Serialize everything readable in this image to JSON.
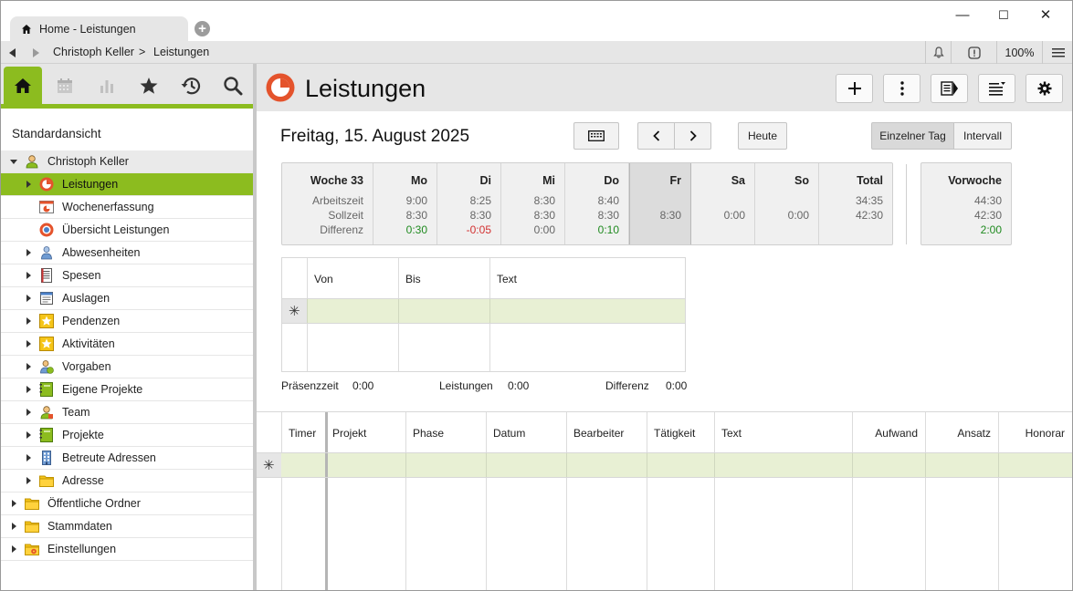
{
  "window": {
    "tab_title": "Home - Leistungen",
    "minimize": "—",
    "maximize": "☐",
    "close": "✕"
  },
  "address": {
    "crumbs": [
      "Christoph Keller",
      ">",
      "Leistungen"
    ],
    "zoom": "100%"
  },
  "sidebar": {
    "heading": "Standardansicht",
    "items": [
      {
        "label": "Christoph Keller",
        "level": 0,
        "expander": "down",
        "icon": "user-icon",
        "state": "grey"
      },
      {
        "label": "Leistungen",
        "level": 1,
        "expander": "right",
        "icon": "leistungen-icon",
        "state": "selected"
      },
      {
        "label": "Wochenerfassung",
        "level": 1,
        "expander": "none",
        "icon": "wochenerfassung-icon",
        "state": ""
      },
      {
        "label": "Übersicht Leistungen",
        "level": 1,
        "expander": "none",
        "icon": "uebersicht-icon",
        "state": ""
      },
      {
        "label": "Abwesenheiten",
        "level": 1,
        "expander": "right",
        "icon": "absence-icon",
        "state": ""
      },
      {
        "label": "Spesen",
        "level": 1,
        "expander": "right",
        "icon": "spesen-icon",
        "state": ""
      },
      {
        "label": "Auslagen",
        "level": 1,
        "expander": "right",
        "icon": "auslagen-icon",
        "state": ""
      },
      {
        "label": "Pendenzen",
        "level": 1,
        "expander": "right",
        "icon": "star-box-icon",
        "state": ""
      },
      {
        "label": "Aktivitäten",
        "level": 1,
        "expander": "right",
        "icon": "star-box-icon",
        "state": ""
      },
      {
        "label": "Vorgaben",
        "level": 1,
        "expander": "right",
        "icon": "vorgaben-icon",
        "state": ""
      },
      {
        "label": "Eigene Projekte",
        "level": 1,
        "expander": "right",
        "icon": "project-icon",
        "state": ""
      },
      {
        "label": "Team",
        "level": 1,
        "expander": "right",
        "icon": "team-icon",
        "state": ""
      },
      {
        "label": "Projekte",
        "level": 1,
        "expander": "right",
        "icon": "project-icon",
        "state": ""
      },
      {
        "label": "Betreute Adressen",
        "level": 1,
        "expander": "right",
        "icon": "building-icon",
        "state": ""
      },
      {
        "label": "Adresse",
        "level": 1,
        "expander": "right",
        "icon": "folder-icon",
        "state": ""
      },
      {
        "label": "Öffentliche Ordner",
        "level": 0,
        "expander": "right",
        "icon": "folder-icon",
        "state": ""
      },
      {
        "label": "Stammdaten",
        "level": 0,
        "expander": "right",
        "icon": "folder-icon",
        "state": ""
      },
      {
        "label": "Einstellungen",
        "level": 0,
        "expander": "right",
        "icon": "settings-folder-icon",
        "state": ""
      }
    ]
  },
  "main": {
    "title": "Leistungen",
    "date": "Freitag, 15. August 2025",
    "today_btn": "Heute",
    "view_single": "Einzelner Tag",
    "view_interval": "Intervall",
    "week": {
      "label": "Woche 33",
      "row_labels": [
        "Arbeitszeit",
        "Sollzeit",
        "Differenz"
      ],
      "days": [
        {
          "name": "Mo",
          "arbeitszeit": "9:00",
          "sollzeit": "8:30",
          "differenz": "0:30",
          "diff_state": "positive"
        },
        {
          "name": "Di",
          "arbeitszeit": "8:25",
          "sollzeit": "8:30",
          "differenz": "-0:05",
          "diff_state": "negative"
        },
        {
          "name": "Mi",
          "arbeitszeit": "8:30",
          "sollzeit": "8:30",
          "differenz": "0:00",
          "diff_state": "neutral"
        },
        {
          "name": "Do",
          "arbeitszeit": "8:40",
          "sollzeit": "8:30",
          "differenz": "0:10",
          "diff_state": "positive"
        },
        {
          "name": "Fr",
          "arbeitszeit": "",
          "sollzeit": "8:30",
          "differenz": "",
          "diff_state": "today"
        },
        {
          "name": "Sa",
          "arbeitszeit": "",
          "sollzeit": "0:00",
          "differenz": "",
          "diff_state": ""
        },
        {
          "name": "So",
          "arbeitszeit": "",
          "sollzeit": "0:00",
          "differenz": "",
          "diff_state": ""
        },
        {
          "name": "Total",
          "arbeitszeit": "34:35",
          "sollzeit": "42:30",
          "differenz": "",
          "diff_state": ""
        }
      ],
      "prev": {
        "label": "Vorwoche",
        "arbeitszeit": "44:30",
        "sollzeit": "42:30",
        "differenz": "2:00"
      }
    },
    "time_grid": {
      "columns": [
        "Von",
        "Bis",
        "Text"
      ],
      "new_row_marker": "✳"
    },
    "summary": {
      "praesenz_label": "Präsenzzeit",
      "praesenz_value": "0:00",
      "leistungen_label": "Leistungen",
      "leistungen_value": "0:00",
      "differenz_label": "Differenz",
      "differenz_value": "0:00"
    },
    "entries_grid": {
      "columns": [
        "Timer",
        "Projekt",
        "Phase",
        "Datum",
        "Bearbeiter",
        "Tätigkeit",
        "Text",
        "Aufwand",
        "Ansatz",
        "Honorar"
      ],
      "new_row_marker": "✳"
    }
  },
  "colors": {
    "accent": "#8cbc1f",
    "positive": "#1f8a1f",
    "negative": "#d23030",
    "brand_red": "#e4532c"
  }
}
